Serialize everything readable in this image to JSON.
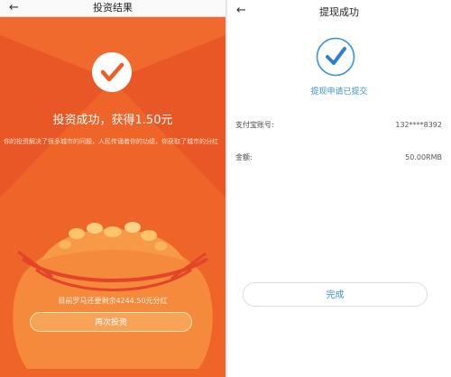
{
  "left": {
    "title": "投资结果",
    "back_icon": "←",
    "headline": "投资成功，获得1.50元",
    "description": "你的投资解决了很多城市的问题，人民传诵着你的功绩，你获取了城市的分红",
    "remaining": "目前罗马还要剩余4244.50元分红",
    "again_button": "再次投资",
    "colors": {
      "background": "#ec5d28",
      "accent": "#f47332",
      "check": "#ec5d28"
    }
  },
  "right": {
    "title": "提现成功",
    "back_icon": "←",
    "status": "提现申请已提交",
    "rows": [
      {
        "label": "支付宝账号:",
        "value": "132****8392"
      },
      {
        "label": "金额:",
        "value": "50.00RMB"
      }
    ],
    "done_button": "完成",
    "colors": {
      "accent": "#3d8fdb"
    }
  }
}
